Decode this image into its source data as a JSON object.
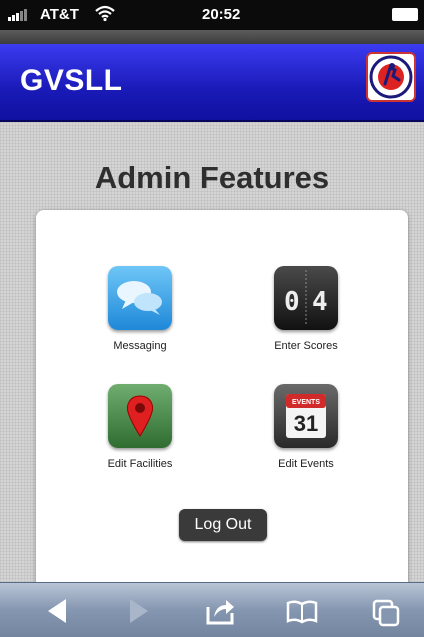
{
  "status_bar": {
    "carrier": "AT&T",
    "time": "20:52",
    "icons": [
      "signal-icon",
      "wifi-icon",
      "battery-icon"
    ]
  },
  "header": {
    "title": "GVSLL",
    "logo_icon": "little-league-baseball-logo",
    "colors": {
      "header_blue": "#1a1ab8"
    }
  },
  "main": {
    "page_title": "Admin Features",
    "features": [
      {
        "label": "Messaging",
        "icon": "chat-bubbles-icon"
      },
      {
        "label": "Enter Scores",
        "icon": "scoreboard-icon"
      },
      {
        "label": "Edit Facilities",
        "icon": "map-pin-icon"
      },
      {
        "label": "Edit Events",
        "icon": "calendar-icon"
      }
    ],
    "logout_label": "Log Out"
  },
  "icon_text": {
    "scoreboard_left": "0",
    "scoreboard_right": "4",
    "calendar_header": "EVENTS",
    "calendar_day": "31"
  },
  "toolbar": {
    "buttons": [
      "back-icon",
      "forward-icon",
      "share-icon",
      "bookmarks-icon",
      "tabs-icon"
    ]
  }
}
